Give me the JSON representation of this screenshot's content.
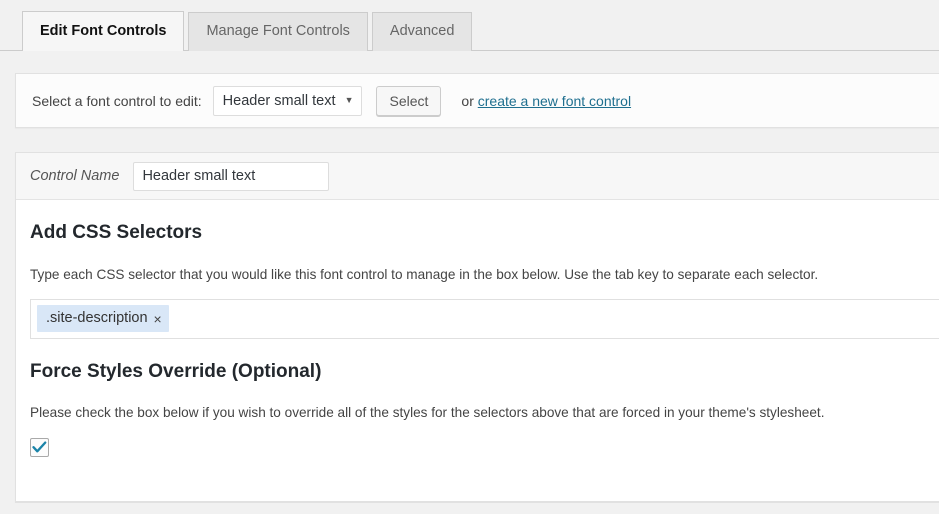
{
  "tabs": [
    {
      "label": "Edit Font Controls",
      "active": true
    },
    {
      "label": "Manage Font Controls",
      "active": false
    },
    {
      "label": "Advanced",
      "active": false
    }
  ],
  "select_row": {
    "label": "Select a font control to edit:",
    "dropdown_value": "Header small text",
    "dropdown_caret": "▼",
    "select_button": "Select",
    "or_text": "or",
    "create_link": "create a new font control"
  },
  "control_name": {
    "label": "Control Name",
    "value": "Header small text",
    "placeholder": "Control Name"
  },
  "css_selectors": {
    "heading": "Add CSS Selectors",
    "description": "Type each CSS selector that you would like this font control to manage in the box below. Use the tab key to separate each selector.",
    "tags": [
      {
        "text": ".site-description",
        "remove": "×"
      }
    ]
  },
  "force_override": {
    "heading": "Force Styles Override (Optional)",
    "description": "Please check the box below if you wish to override all of the styles for the selectors above that are forced in your theme's stylesheet.",
    "checked": true,
    "check_glyph": "✓"
  },
  "colors": {
    "accent_link": "#1f6f8f",
    "tag_background": "#d9e7f7",
    "checkmark": "#1a83a8",
    "page_background": "#f1f1f1",
    "panel_background": "#ffffff"
  }
}
